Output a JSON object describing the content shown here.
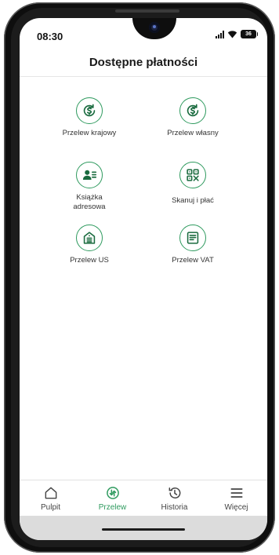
{
  "status_bar": {
    "time": "08:30",
    "battery": "36"
  },
  "header": {
    "title": "Dostępne płatności"
  },
  "tiles": [
    {
      "label": "Przelew krajowy",
      "icon": "dollar-cycle-icon"
    },
    {
      "label": "Przelew własny",
      "icon": "dollar-cycle-icon"
    },
    {
      "label": "Książka adresowa",
      "icon": "address-book-icon"
    },
    {
      "label": "Skanuj i płać",
      "icon": "qr-code-icon"
    },
    {
      "label": "Przelew US",
      "icon": "tax-office-icon"
    },
    {
      "label": "Przelew VAT",
      "icon": "vat-document-icon"
    }
  ],
  "bottom_nav": {
    "items": [
      {
        "label": "Pulpit",
        "icon": "home-icon",
        "active": false
      },
      {
        "label": "Przelew",
        "icon": "transfer-icon",
        "active": true
      },
      {
        "label": "Historia",
        "icon": "history-icon",
        "active": false
      },
      {
        "label": "Więcej",
        "icon": "menu-icon",
        "active": false
      }
    ]
  },
  "colors": {
    "accent": "#2e9a5e",
    "text": "#333333",
    "nav_background": "#ffffff",
    "gesture_area": "#dcdcdc"
  }
}
